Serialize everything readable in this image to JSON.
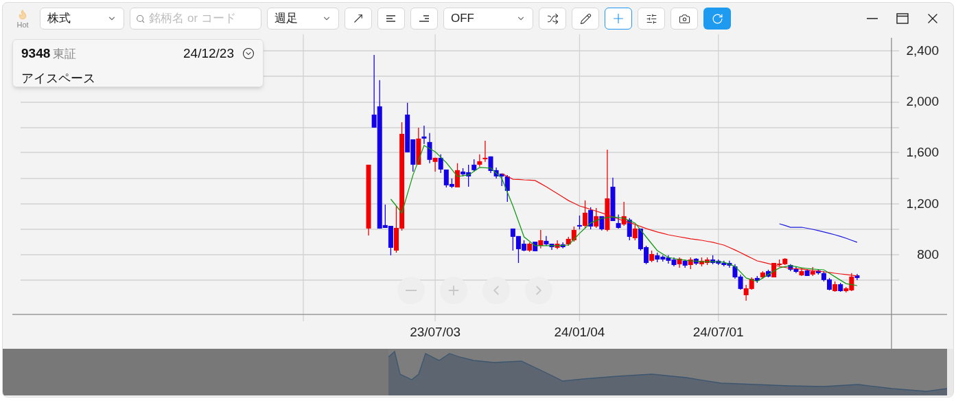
{
  "toolbar": {
    "hot_label": "Hot",
    "market_select": {
      "value": "株式"
    },
    "search": {
      "placeholder": "銘柄名 or コード"
    },
    "period_select": {
      "value": "週足"
    },
    "overlay_select": {
      "value": "OFF"
    },
    "tools": [
      {
        "selected": false
      },
      {
        "selected": false
      },
      {
        "selected": false
      },
      {
        "selected": false
      },
      {
        "selected": false
      },
      {
        "selected": true
      },
      {
        "selected": false
      },
      {
        "selected": false
      }
    ]
  },
  "info_card": {
    "code": "9348",
    "exchange": "東証",
    "date": "24/12/23",
    "name": "アイスペース"
  },
  "chart": {
    "chart_data": {
      "type": "candlestick",
      "categories": [
        null,
        null,
        null,
        null,
        null,
        null,
        null,
        null,
        null,
        null,
        null,
        null,
        "23/07/03",
        null,
        null,
        null,
        null,
        null,
        null,
        null,
        null,
        null,
        null,
        null,
        null,
        null,
        null,
        null,
        null,
        null,
        null,
        null,
        null,
        null,
        null,
        null,
        null,
        null,
        "24/01/04",
        null,
        null,
        null,
        null,
        null,
        null,
        null,
        null,
        null,
        null,
        null,
        null,
        null,
        null,
        null,
        null,
        null,
        null,
        null,
        null,
        null,
        null,
        null,
        null,
        "24/07/01",
        null,
        null,
        null,
        null,
        null,
        null,
        null,
        null,
        null,
        null,
        null,
        null,
        null,
        null,
        null,
        null,
        null,
        null,
        null,
        null,
        null,
        null,
        null,
        null,
        null
      ],
      "ylim": [
        331,
        2529
      ],
      "grid": true,
      "yticks": [
        {
          "value": 2400,
          "label": "2,400"
        },
        {
          "value": 2000,
          "label": "2,000"
        },
        {
          "value": 1600,
          "label": "1,600"
        },
        {
          "value": 1200,
          "label": "1,200"
        },
        {
          "value": 800,
          "label": "800"
        }
      ],
      "ohlc": [
        [
          1005,
          1506,
          951,
          1506
        ],
        [
          1899,
          2368,
          1797,
          1797
        ],
        [
          1964,
          2169,
          1005,
          1005
        ],
        [
          1032,
          1193,
          1010,
          1010
        ],
        [
          1026,
          1026,
          795,
          854
        ],
        [
          832,
          1183,
          816,
          1010
        ],
        [
          1005,
          1840,
          989,
          1748
        ],
        [
          1899,
          1991,
          1603,
          1603
        ],
        [
          1705,
          1705,
          1452,
          1506
        ],
        [
          1506,
          1797,
          1506,
          1711
        ],
        [
          1727,
          1813,
          1668,
          1711
        ],
        [
          1684,
          1754,
          1517,
          1544
        ],
        [
          1528,
          1560,
          1452,
          1560
        ],
        [
          1560,
          1587,
          1441,
          1468
        ],
        [
          1468,
          1468,
          1328,
          1344
        ],
        [
          1355,
          1398,
          1323,
          1333
        ],
        [
          1328,
          1517,
          1328,
          1463
        ],
        [
          1452,
          1479,
          1414,
          1430
        ],
        [
          1447,
          1506,
          1333,
          1414
        ],
        [
          1506,
          1549,
          1452,
          1463
        ],
        [
          1506,
          1587,
          1490,
          1533
        ],
        [
          1549,
          1694,
          1528,
          1560
        ],
        [
          1571,
          1571,
          1441,
          1457
        ],
        [
          1463,
          1484,
          1398,
          1414
        ],
        [
          1436,
          1436,
          1339,
          1414
        ],
        [
          1414,
          1425,
          1215,
          1301
        ],
        [
          1005,
          1005,
          832,
          940
        ],
        [
          946,
          946,
          735,
          843
        ],
        [
          886,
          913,
          827,
          832
        ],
        [
          832,
          897,
          822,
          886
        ],
        [
          902,
          902,
          827,
          827
        ],
        [
          870,
          994,
          849,
          913
        ],
        [
          908,
          946,
          870,
          881
        ],
        [
          886,
          886,
          838,
          859
        ],
        [
          854,
          913,
          843,
          886
        ],
        [
          881,
          897,
          849,
          859
        ],
        [
          881,
          940,
          870,
          924
        ],
        [
          913,
          1021,
          902,
          994
        ],
        [
          1032,
          1107,
          999,
          1021
        ],
        [
          1026,
          1226,
          1010,
          1129
        ],
        [
          1150,
          1172,
          999,
          1021
        ],
        [
          1021,
          1166,
          1010,
          1102
        ],
        [
          1102,
          1102,
          989,
          999
        ],
        [
          994,
          1624,
          983,
          1242
        ],
        [
          1333,
          1404,
          1064,
          1064
        ],
        [
          1048,
          1115,
          1005,
          1010
        ],
        [
          1037,
          1215,
          1026,
          1102
        ],
        [
          1075,
          1086,
          913,
          940
        ],
        [
          929,
          1032,
          913,
          1005
        ],
        [
          1005,
          1005,
          832,
          843
        ],
        [
          859,
          870,
          725,
          735
        ],
        [
          752,
          832,
          741,
          805
        ],
        [
          795,
          816,
          741,
          762
        ],
        [
          784,
          795,
          746,
          762
        ],
        [
          778,
          795,
          730,
          752
        ],
        [
          762,
          778,
          708,
          719
        ],
        [
          725,
          778,
          698,
          768
        ],
        [
          752,
          762,
          698,
          714
        ],
        [
          719,
          778,
          687,
          762
        ],
        [
          768,
          773,
          719,
          730
        ],
        [
          725,
          778,
          708,
          752
        ],
        [
          735,
          778,
          719,
          762
        ],
        [
          762,
          795,
          725,
          735
        ],
        [
          752,
          762,
          719,
          730
        ],
        [
          735,
          752,
          708,
          719
        ],
        [
          735,
          752,
          698,
          714
        ],
        [
          708,
          725,
          611,
          622
        ],
        [
          628,
          644,
          525,
          531
        ],
        [
          482,
          563,
          439,
          536
        ],
        [
          531,
          622,
          525,
          611
        ],
        [
          617,
          633,
          579,
          595
        ],
        [
          622,
          671,
          611,
          660
        ],
        [
          671,
          682,
          622,
          628
        ],
        [
          622,
          735,
          622,
          735
        ],
        [
          719,
          762,
          708,
          730
        ],
        [
          725,
          773,
          719,
          768
        ],
        [
          719,
          725,
          671,
          682
        ],
        [
          687,
          708,
          655,
          665
        ],
        [
          638,
          698,
          633,
          671
        ],
        [
          676,
          687,
          633,
          633
        ],
        [
          644,
          703,
          633,
          671
        ],
        [
          676,
          687,
          644,
          655
        ],
        [
          655,
          671,
          590,
          601
        ],
        [
          606,
          617,
          520,
          525
        ],
        [
          514,
          590,
          509,
          568
        ],
        [
          568,
          579,
          509,
          514
        ],
        [
          514,
          547,
          504,
          536
        ],
        [
          520,
          655,
          514,
          628
        ],
        [
          638,
          649,
          601,
          617
        ]
      ],
      "series": [
        {
          "type": "line",
          "color": "#119911",
          "values": [
            null,
            null,
            null,
            null,
            1236,
            1182,
            1128,
            1277,
            1425,
            1540,
            1656,
            1632,
            1608,
            1565,
            1522,
            1468,
            1414,
            1420,
            1425,
            1455,
            1484,
            1482,
            1479,
            1439,
            1398,
            1290,
            1182,
            1061,
            940,
            905,
            870,
            870,
            870,
            870,
            870,
            873,
            875,
            921,
            967,
            1008,
            1048,
            1067,
            1085,
            1091,
            1096,
            1091,
            1085,
            1067,
            1048,
            994,
            940,
            886,
            832,
            805,
            778,
            770,
            762,
            757,
            751,
            749,
            746,
            746,
            746,
            744,
            741,
            725,
            708,
            663,
            617,
            604,
            590,
            617,
            644,
            671,
            697,
            706,
            714,
            706,
            697,
            692,
            687,
            684,
            681,
            654,
            627,
            600,
            573,
            565,
            557
          ]
        },
        {
          "type": "line",
          "color": "#ee1111",
          "values": [
            null,
            null,
            null,
            null,
            null,
            null,
            null,
            null,
            null,
            null,
            null,
            null,
            null,
            null,
            null,
            null,
            null,
            null,
            null,
            null,
            null,
            null,
            null,
            null,
            1436,
            1414,
            1392,
            1390,
            1387,
            1385,
            1382,
            1358,
            1333,
            1306,
            1279,
            1252,
            1225,
            1204,
            1182,
            1169,
            1155,
            1142,
            1128,
            1112,
            1096,
            1080,
            1064,
            1051,
            1037,
            1021,
            1005,
            992,
            978,
            967,
            956,
            948,
            940,
            932,
            924,
            919,
            913,
            905,
            897,
            886,
            875,
            856,
            837,
            816,
            794,
            773,
            751,
            741,
            730,
            719,
            708,
            700,
            692,
            690,
            687,
            682,
            676,
            671,
            665,
            660,
            654,
            649,
            644,
            639,
            633
          ]
        },
        {
          "type": "line",
          "color": "#1a1ae0",
          "values": [
            null,
            null,
            null,
            null,
            null,
            null,
            null,
            null,
            null,
            null,
            null,
            null,
            null,
            null,
            null,
            null,
            null,
            null,
            null,
            null,
            null,
            null,
            null,
            null,
            null,
            null,
            null,
            null,
            null,
            null,
            null,
            null,
            null,
            null,
            null,
            null,
            null,
            null,
            null,
            null,
            null,
            null,
            null,
            null,
            null,
            null,
            null,
            null,
            null,
            null,
            null,
            null,
            null,
            null,
            null,
            null,
            null,
            null,
            null,
            null,
            null,
            null,
            null,
            null,
            null,
            null,
            null,
            null,
            null,
            null,
            null,
            null,
            null,
            null,
            1042,
            1029,
            1015,
            1015,
            1015,
            1007,
            999,
            989,
            978,
            967,
            956,
            943,
            929,
            913,
            897
          ]
        }
      ]
    }
  }
}
